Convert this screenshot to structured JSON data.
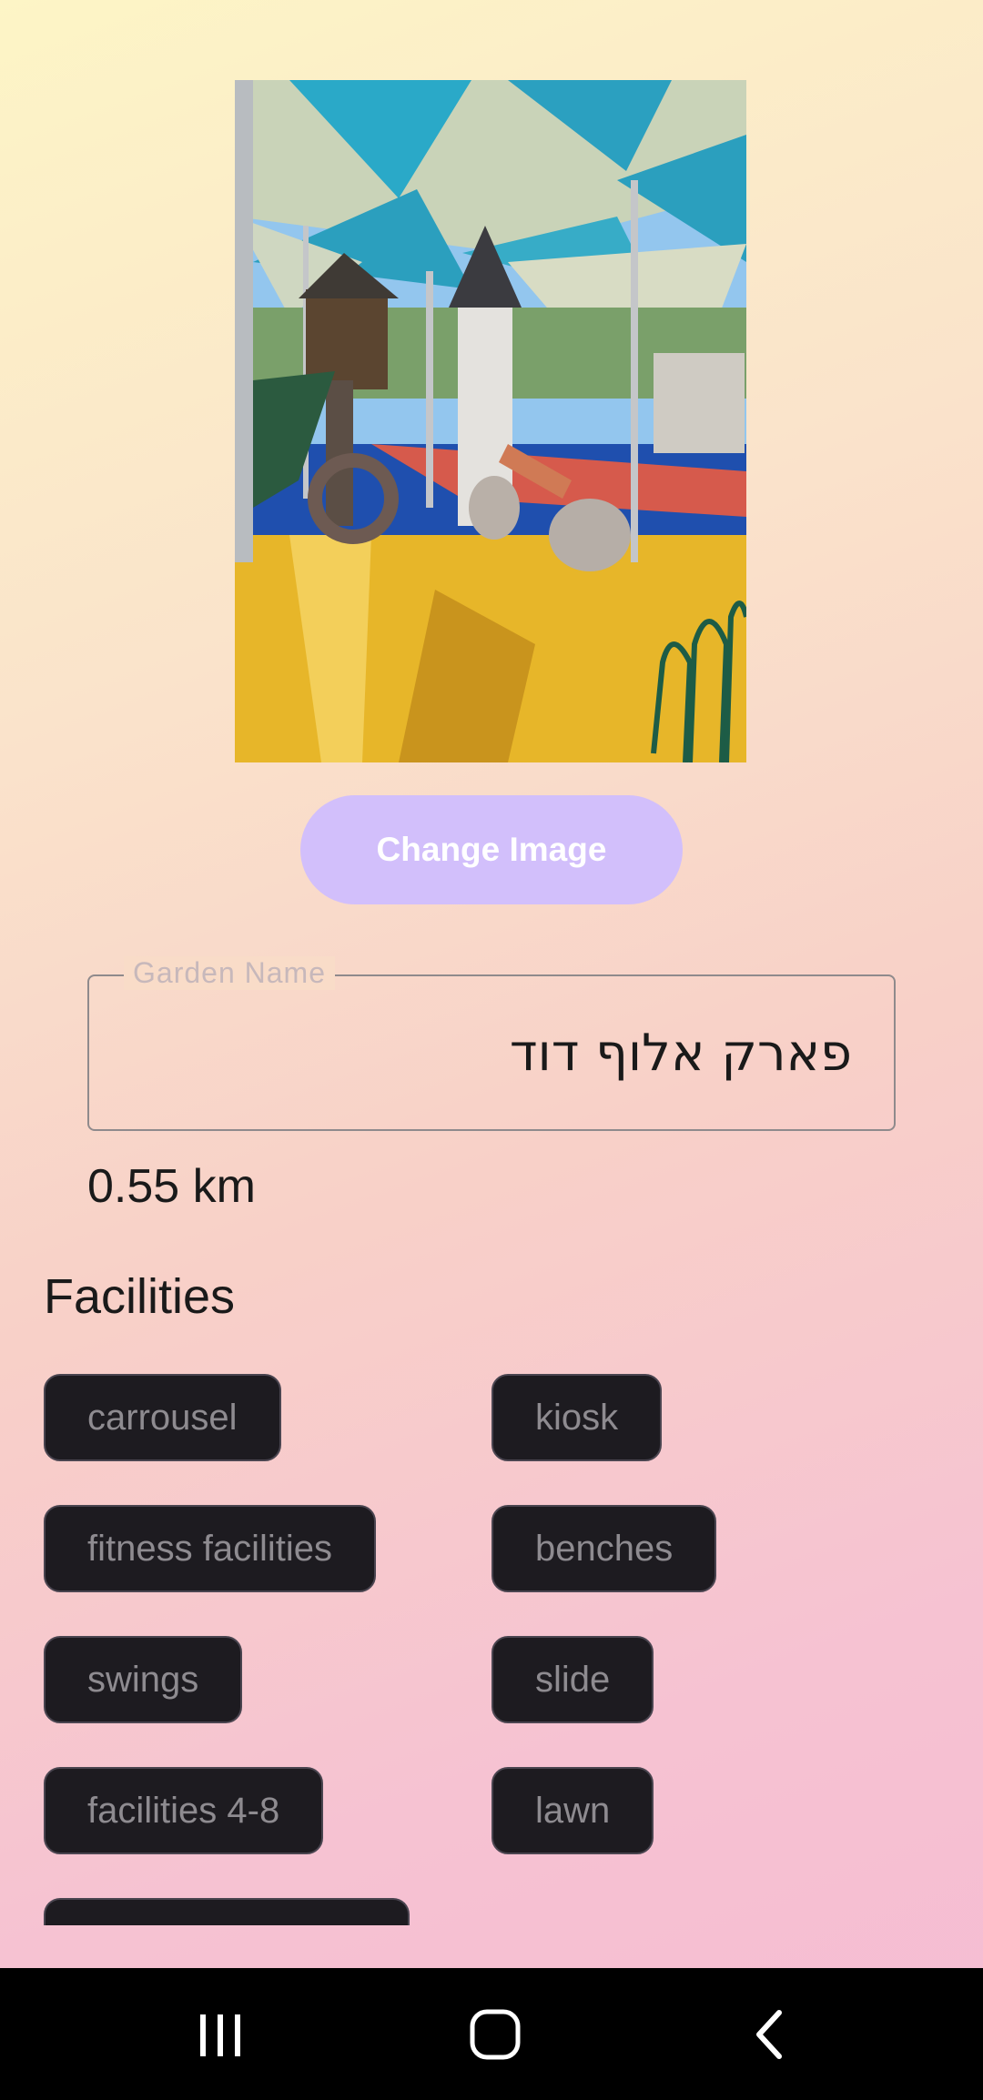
{
  "image_button": {
    "label": "Change Image"
  },
  "garden_name": {
    "label": "Garden Name",
    "value": "פארק אלוף דוד"
  },
  "distance": "0.55 km",
  "facilities": {
    "title": "Facilities",
    "chips": [
      "carrousel",
      "kiosk",
      "fitness facilities",
      "benches",
      "swings",
      "slide",
      "facilities 4-8",
      "lawn"
    ]
  },
  "colors": {
    "accent_button": "#d2bffb",
    "chip_background": "#1d1b20",
    "chip_text": "#8e8b90"
  },
  "nav_icons": [
    "recent-apps-icon",
    "home-icon",
    "back-icon"
  ]
}
